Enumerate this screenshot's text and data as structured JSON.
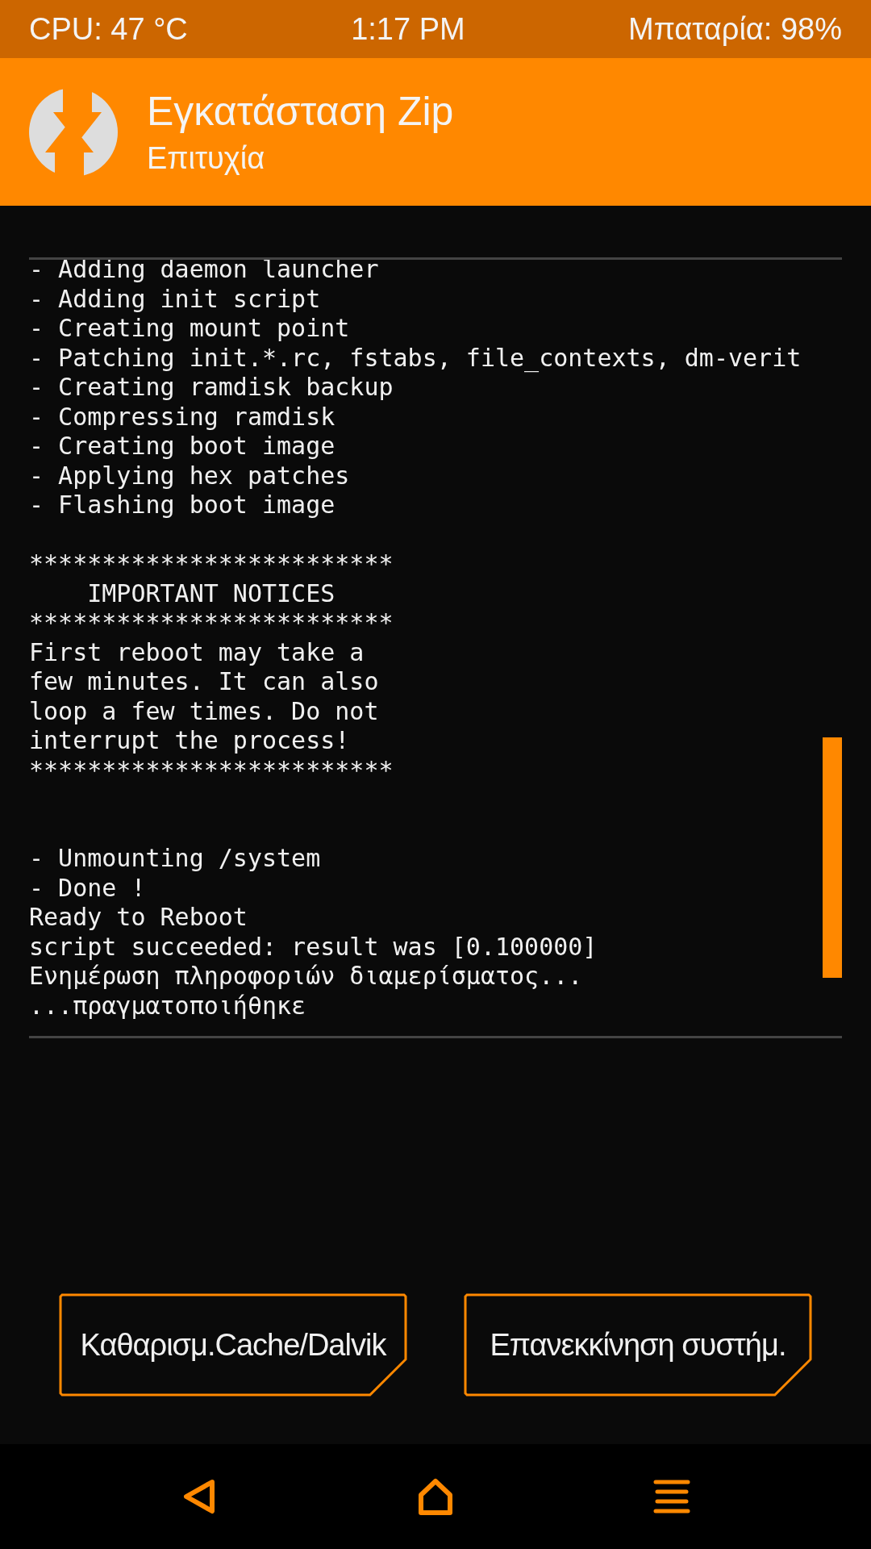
{
  "status_bar": {
    "cpu": "CPU: 47 °C",
    "time": "1:17 PM",
    "battery": "Μπαταρία: 98%"
  },
  "header": {
    "title": "Εγκατάσταση Zip",
    "subtitle": "Επιτυχία"
  },
  "console": {
    "lines": [
      {
        "kind": "text",
        "text": "- Adding daemon launcher"
      },
      {
        "kind": "text",
        "text": "- Adding init script"
      },
      {
        "kind": "text",
        "text": "- Creating mount point"
      },
      {
        "kind": "text",
        "text": "- Patching init.*.rc, fstabs, file_contexts, dm-verit"
      },
      {
        "kind": "text",
        "text": "- Creating ramdisk backup"
      },
      {
        "kind": "text",
        "text": "- Compressing ramdisk"
      },
      {
        "kind": "text",
        "text": "- Creating boot image"
      },
      {
        "kind": "text",
        "text": "- Applying hex patches"
      },
      {
        "kind": "text",
        "text": "- Flashing boot image"
      },
      {
        "kind": "blank"
      },
      {
        "kind": "text",
        "text": "*************************"
      },
      {
        "kind": "text",
        "text": "    IMPORTANT NOTICES"
      },
      {
        "kind": "text",
        "text": "*************************"
      },
      {
        "kind": "text",
        "text": "First reboot may take a"
      },
      {
        "kind": "text",
        "text": "few minutes. It can also"
      },
      {
        "kind": "text",
        "text": "loop a few times. Do not"
      },
      {
        "kind": "text",
        "text": "interrupt the process!"
      },
      {
        "kind": "text",
        "text": "*************************"
      },
      {
        "kind": "blank"
      },
      {
        "kind": "blank"
      },
      {
        "kind": "text",
        "text": "- Unmounting /system"
      },
      {
        "kind": "text",
        "text": "- Done !"
      },
      {
        "kind": "text",
        "text": "Ready to Reboot"
      },
      {
        "kind": "text",
        "text": "script succeeded: result was [0.100000]"
      },
      {
        "kind": "text",
        "text": "Ενημέρωση πληροφοριών διαμερίσματος..."
      },
      {
        "kind": "text",
        "text": "...πραγματοποιήθηκε"
      }
    ]
  },
  "buttons": [
    {
      "label": "Καθαρισμ.Cache/Dalvik"
    },
    {
      "label": "Επανεκκίνηση συστήμ."
    }
  ],
  "nav_bar": [
    {
      "kind": "back"
    },
    {
      "kind": "home"
    },
    {
      "kind": "menu"
    }
  ]
}
